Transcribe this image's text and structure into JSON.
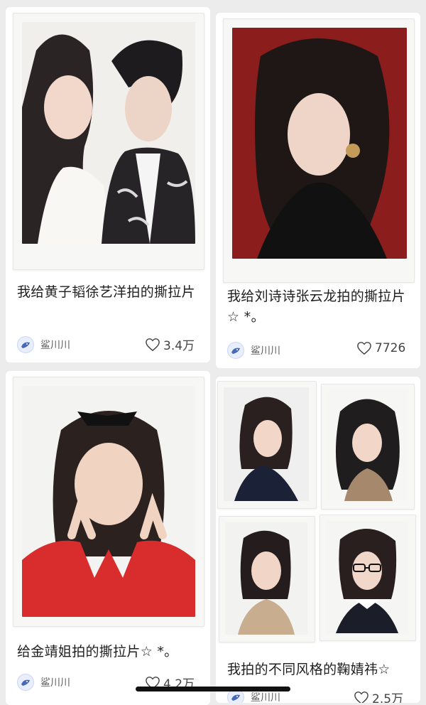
{
  "feed": {
    "cards": [
      {
        "title": "我给黄子韬徐艺洋拍的撕拉片",
        "author": "鲨川川",
        "likes": "3.4万"
      },
      {
        "title": "我给刘诗诗张云龙拍的撕拉片☆ *。",
        "author": "鲨川川",
        "likes": "7726"
      },
      {
        "title": "给金靖姐拍的撕拉片☆ *。",
        "author": "鲨川川",
        "likes": "4.2万"
      },
      {
        "title": "我拍的不同风格的鞠婧祎☆",
        "author": "鲨川川",
        "likes": "2.5万"
      }
    ]
  },
  "colors": {
    "background": "#ececec",
    "card": "#ffffff",
    "text_primary": "#1f1f1f",
    "text_secondary": "#5f5f5f"
  },
  "icons": {
    "like": "heart-outline-icon",
    "avatar": "shark-avatar-icon"
  }
}
